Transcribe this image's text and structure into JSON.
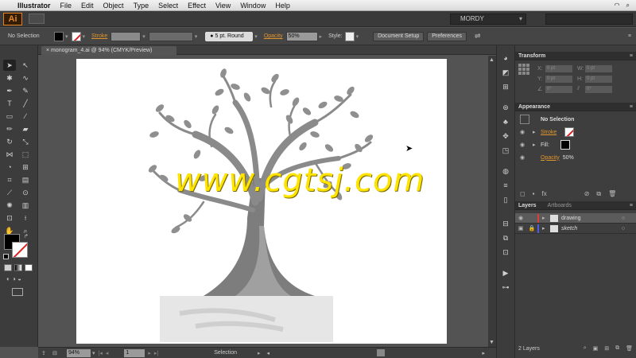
{
  "menubar": {
    "app_name": "Illustrator",
    "items": [
      "File",
      "Edit",
      "Object",
      "Type",
      "Select",
      "Effect",
      "View",
      "Window",
      "Help"
    ]
  },
  "appbar": {
    "logo": "Ai",
    "workspace": "MORDY"
  },
  "control": {
    "selection_label": "No Selection",
    "stroke_label": "Stroke",
    "brush_label": "5 pt. Round",
    "opacity_label": "Opacity",
    "opacity_value": "50%",
    "style_label": "Style:",
    "document_setup": "Document Setup",
    "preferences": "Preferences"
  },
  "document": {
    "tab_title": "monogram_4.ai @ 94% (CMYK/Preview)"
  },
  "status": {
    "zoom": "94%",
    "page": "1",
    "mode": "Selection"
  },
  "transform_panel": {
    "title": "Transform",
    "x_label": "X:",
    "x_value": "0 pt",
    "y_label": "Y:",
    "y_value": "0 pt",
    "w_label": "W:",
    "w_value": "0 pt",
    "h_label": "H:",
    "h_value": "0 pt",
    "angle_value": "0°",
    "shear_value": "0°"
  },
  "appearance_panel": {
    "title": "Appearance",
    "selection": "No Selection",
    "stroke": "Stroke",
    "fill": "Fill:",
    "opacity": "Opacity",
    "opacity_value": "50%"
  },
  "layers_panel": {
    "title": "Layers",
    "tab2": "Artboards",
    "layers": [
      {
        "name": "drawing",
        "color": "#e03a3a"
      },
      {
        "name": "sketch",
        "color": "#4a5fe0"
      }
    ],
    "count": "2 Layers"
  },
  "watermark": "www.cgtsj.com",
  "colors": {
    "accent_orange": "#e0952c",
    "ui_dark": "#3c3c3c",
    "watermark": "#ffe400"
  }
}
